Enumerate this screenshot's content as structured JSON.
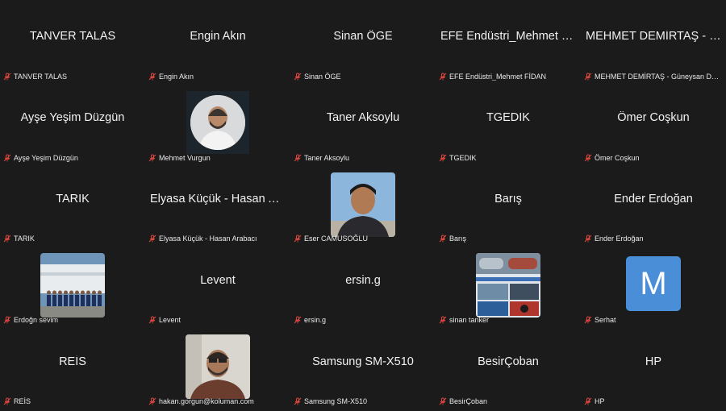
{
  "meeting": {
    "accent_color": "#4a8ed8",
    "mic_muted_color": "#e0463e",
    "participants": [
      {
        "name": "TANVER TALAS",
        "label": "TANVER TALAS",
        "video": "none"
      },
      {
        "name": "Engin Akın",
        "label": "Engin Akın",
        "video": "none"
      },
      {
        "name": "Sinan ÖGE",
        "label": "Sinan ÖGE",
        "video": "none"
      },
      {
        "name": "EFE Endüstri_Mehmet Fİ…",
        "label": "EFE Endüstri_Mehmet FİDAN",
        "video": "none"
      },
      {
        "name": "MEHMET DEMİRTAŞ - G…",
        "label": "MEHMET DEMİRTAŞ - Güneysan Dorse",
        "video": "none"
      },
      {
        "name": "Ayşe Yeşim Düzgün",
        "label": "Ayşe Yeşim Düzgün",
        "video": "none"
      },
      {
        "name": "",
        "label": "Mehmet Vurgun",
        "video": "avatar-photo"
      },
      {
        "name": "Taner Aksoylu",
        "label": "Taner Aksoylu",
        "video": "none"
      },
      {
        "name": "TGEDIK",
        "label": "TGEDIK",
        "video": "none"
      },
      {
        "name": "Ömer Coşkun",
        "label": "Ömer Coşkun",
        "video": "none"
      },
      {
        "name": "TARIK",
        "label": "TARIK",
        "video": "none"
      },
      {
        "name": "Elyasa Küçük - Hasan Ar…",
        "label": "Elyasa Küçük - Hasan Arabacı",
        "video": "none"
      },
      {
        "name": "",
        "label": "Eser CAMUSOĞLU",
        "video": "portrait-photo"
      },
      {
        "name": "Barış",
        "label": "Barış",
        "video": "none"
      },
      {
        "name": "Ender Erdoğan",
        "label": "Ender Erdoğan",
        "video": "none"
      },
      {
        "name": "",
        "label": "Erdoğn sevim",
        "video": "group-photo"
      },
      {
        "name": "Levent",
        "label": "Levent",
        "video": "none"
      },
      {
        "name": "ersin.g",
        "label": "ersin.g",
        "video": "none"
      },
      {
        "name": "",
        "label": "sinan tanker",
        "video": "tanker-photo"
      },
      {
        "name": "",
        "label": "Serhat",
        "video": "letter-avatar",
        "letter": "M"
      },
      {
        "name": "REİS",
        "label": "REİS",
        "video": "none"
      },
      {
        "name": "",
        "label": "hakan.gorgun@koluman.com",
        "video": "portrait-photo-2"
      },
      {
        "name": "Samsung SM-X510",
        "label": "Samsung SM-X510",
        "video": "none"
      },
      {
        "name": "BesirÇoban",
        "label": "BesirÇoban",
        "video": "none"
      },
      {
        "name": "HP",
        "label": "HP",
        "video": "none"
      }
    ]
  }
}
